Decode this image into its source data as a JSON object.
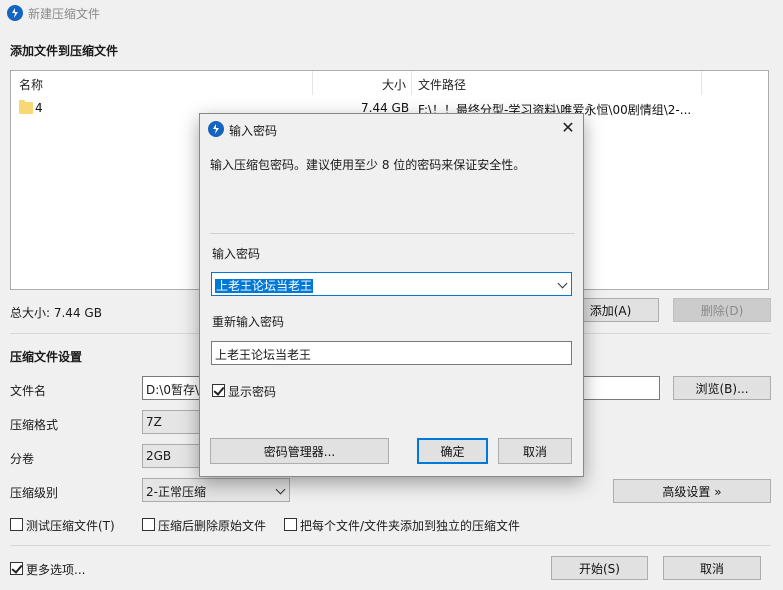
{
  "window": {
    "title": "新建压缩文件"
  },
  "add_section": {
    "heading": "添加文件到压缩文件",
    "columns": {
      "name": "名称",
      "size": "大小",
      "path": "文件路径"
    },
    "rows": [
      {
        "name": "4",
        "size": "7.44 GB",
        "path": "F:\\！！最终分型-学习资料\\唯爱永恒\\00剧情组\\2-..."
      }
    ],
    "total_size": "总大小: 7.44 GB",
    "add_button": "添加(A)",
    "delete_button": "删除(D)"
  },
  "settings": {
    "heading": "压缩文件设置",
    "filename_label": "文件名",
    "filename_value": "D:\\0暂存\\",
    "browse_button": "浏览(B)...",
    "format_label": "压缩格式",
    "format_value": "7Z",
    "split_label": "分卷",
    "split_value": "2GB",
    "level_label": "压缩级别",
    "level_value": "2-正常压缩",
    "advanced_button": "高级设置 »",
    "test_checkbox": "测试压缩文件(T)",
    "delete_after_checkbox": "压缩后删除原始文件",
    "each_file_checkbox": "把每个文件/文件夹添加到独立的压缩文件"
  },
  "footer": {
    "more_options": "更多选项...",
    "start_button": "开始(S)",
    "cancel_button": "取消"
  },
  "dialog": {
    "title": "输入密码",
    "message": "输入压缩包密码。建议使用至少 8 位的密码来保证安全性。",
    "enter_label": "输入密码",
    "enter_value": "上老王论坛当老王",
    "reenter_label": "重新输入密码",
    "reenter_value": "上老王论坛当老王",
    "show_password": "显示密码",
    "manager_button": "密码管理器...",
    "ok_button": "确定",
    "cancel_button": "取消"
  }
}
